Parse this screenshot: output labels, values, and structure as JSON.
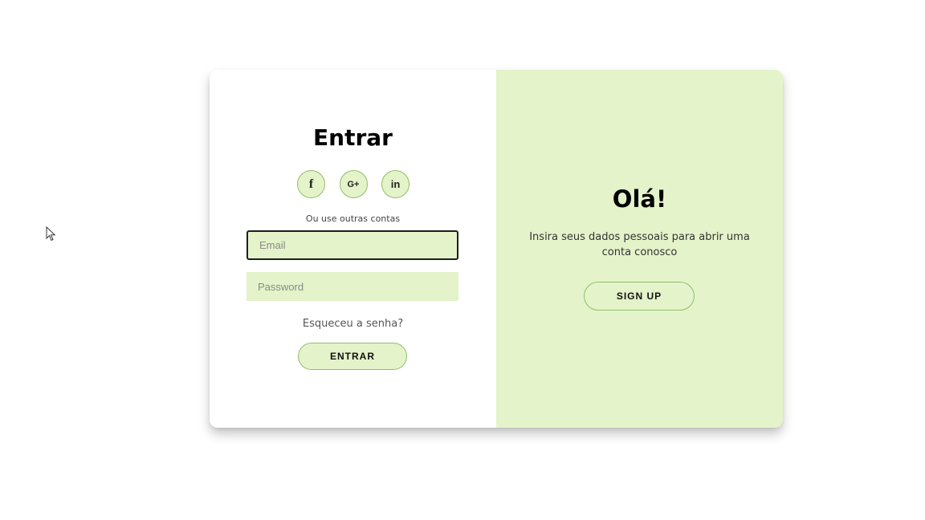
{
  "signin": {
    "title": "Entrar",
    "social": {
      "facebook": "f",
      "google": "G+",
      "linkedin": "in"
    },
    "alt_label": "Ou use outras contas",
    "email_placeholder": "Email",
    "password_placeholder": "Password",
    "forgot_link": "Esqueceu a senha?",
    "submit_label": "ENTRAR"
  },
  "signup": {
    "title": "Olá!",
    "text": "Insira seus dados pessoais para abrir uma conta conosco",
    "button_label": "SIGN UP"
  },
  "colors": {
    "accent": "#e4f3c9",
    "border": "#8fbf6a"
  },
  "icons": {
    "cursor": "mouse-pointer-icon",
    "facebook": "facebook-icon",
    "google": "google-plus-icon",
    "linkedin": "linkedin-icon"
  }
}
